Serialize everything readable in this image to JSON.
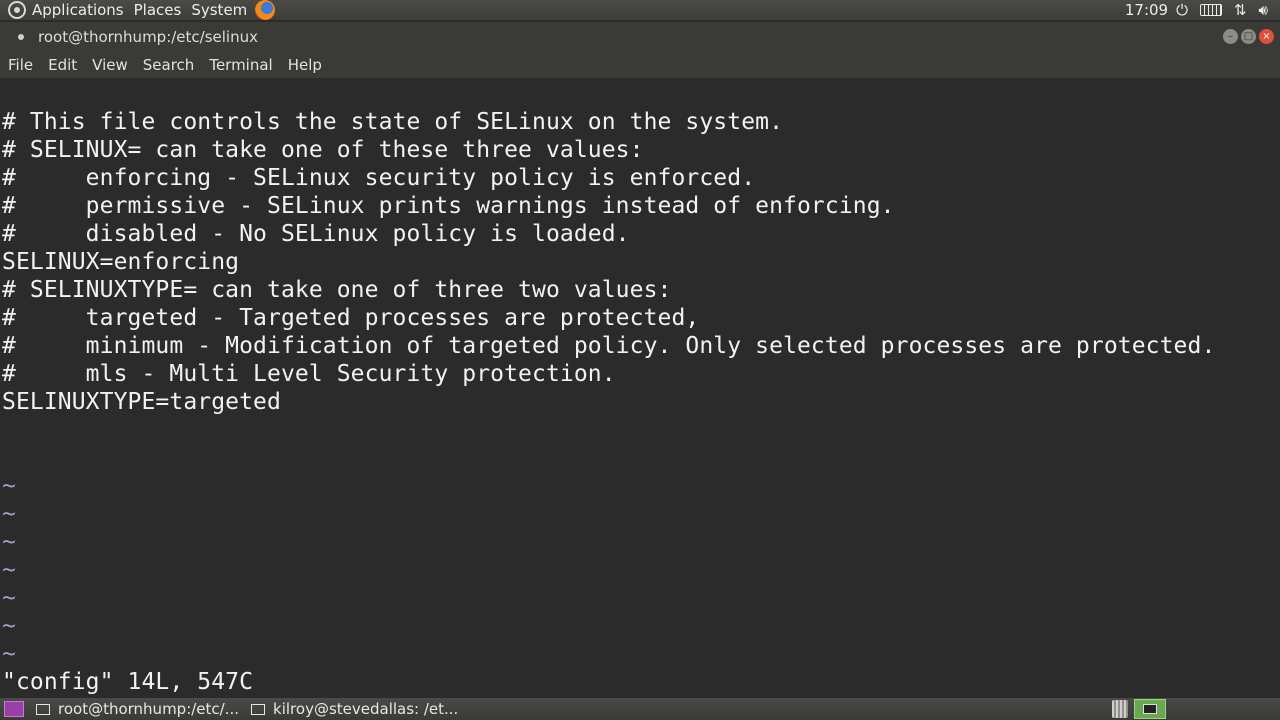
{
  "top_panel": {
    "menus": [
      "Applications",
      "Places",
      "System"
    ],
    "clock": "17:09",
    "icons": [
      "gnome-menu-icon",
      "firefox-icon",
      "power-icon",
      "keyboard-icon",
      "network-icon",
      "volume-icon"
    ]
  },
  "window": {
    "title": "root@thornhump:/etc/selinux"
  },
  "menubar": {
    "items": [
      "File",
      "Edit",
      "View",
      "Search",
      "Terminal",
      "Help"
    ]
  },
  "terminal": {
    "lines": [
      "",
      "# This file controls the state of SELinux on the system.",
      "# SELINUX= can take one of these three values:",
      "#     enforcing - SELinux security policy is enforced.",
      "#     permissive - SELinux prints warnings instead of enforcing.",
      "#     disabled - No SELinux policy is loaded.",
      "SELINUX=enforcing",
      "# SELINUXTYPE= can take one of three two values:",
      "#     targeted - Targeted processes are protected,",
      "#     minimum - Modification of targeted policy. Only selected processes are protected.",
      "#     mls - Multi Level Security protection.",
      "SELINUXTYPE=targeted",
      "",
      "",
      "~",
      "~",
      "~",
      "~",
      "~",
      "~",
      "~"
    ],
    "status_line": "\"config\" 14L, 547C"
  },
  "taskbar": {
    "tasks": [
      "root@thornhump:/etc/...",
      "kilroy@stevedallas: /et..."
    ]
  },
  "colors": {
    "terminal_bg": "#2b2b2b",
    "terminal_fg": "#f2f2f2",
    "tilde": "#9aa0c8",
    "workspace_active": "#6aa84f"
  }
}
